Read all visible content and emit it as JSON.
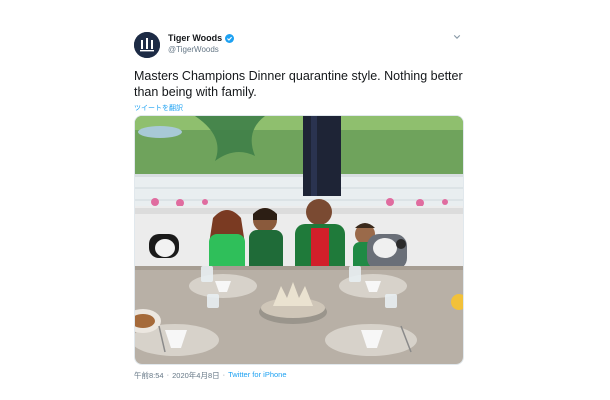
{
  "tweet": {
    "author_name": "Tiger Woods",
    "handle": "@TigerWoods",
    "text": "Masters Champions Dinner quarantine style. Nothing better than being with family.",
    "translate_label": "ツイートを翻訳",
    "time": "午前8:54",
    "separator": "·",
    "date": "2020年4月8日",
    "source": "Twitter for iPhone",
    "photo_alt": "Family at the Masters Champions Dinner table",
    "verified_color": "#1da1f2"
  },
  "icons": {
    "avatar": "tgr-logo",
    "verified": "verified-badge-icon",
    "more": "chevron-down-icon"
  },
  "colors": {
    "text": "#14171a",
    "secondary": "#657786",
    "link": "#1da1f2",
    "masters_green": "#1f7a3a"
  }
}
